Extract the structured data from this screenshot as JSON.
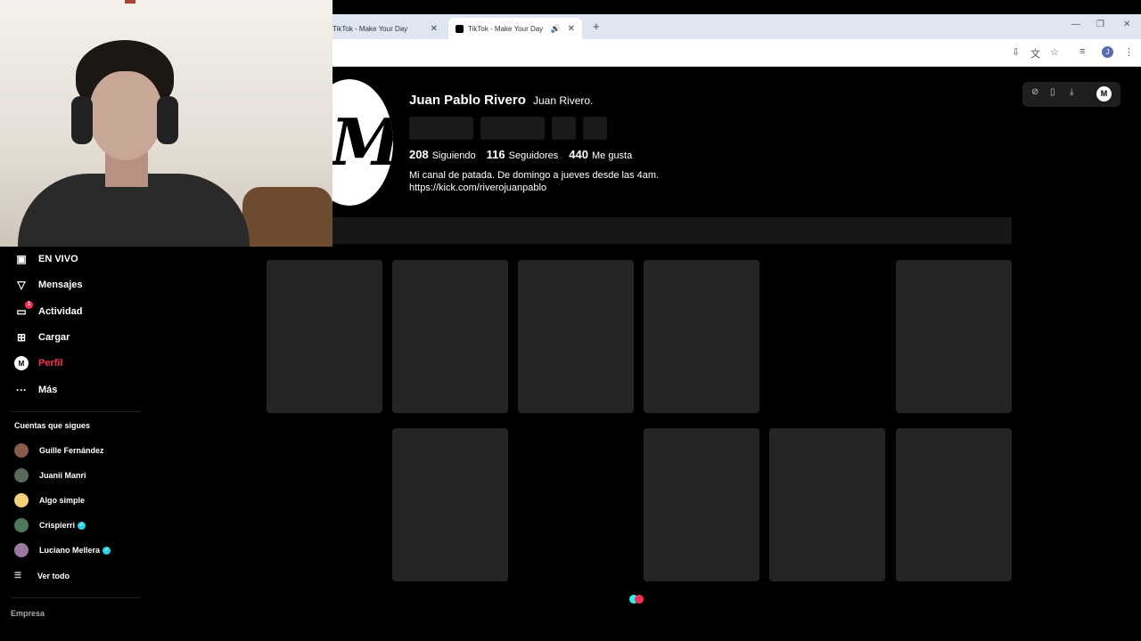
{
  "browser": {
    "tabs": [
      {
        "title": "TikTok - Make Your Day",
        "active": false
      },
      {
        "title": "TikTok - Make Your Day",
        "active": true
      }
    ],
    "new_tab": "+",
    "close_glyph": "✕",
    "speaker_glyph": "🔊",
    "profile_initial": "J",
    "window_controls": [
      "—",
      "❐",
      "✕"
    ]
  },
  "profile": {
    "name": "Juan Pablo Rivero",
    "handle": "Juan Rivero.",
    "stats": [
      {
        "value": "208",
        "label": "Siguiendo"
      },
      {
        "value": "116",
        "label": "Seguidores"
      },
      {
        "value": "440",
        "label": "Me gusta"
      }
    ],
    "bio_line1": "Mi canal de patada. De domingo a jueves desde las 4am.",
    "bio_line2": "https://kick.com/riverojuanpablo",
    "avatar_monogram": "M"
  },
  "sidebar": {
    "items": [
      {
        "label": "EN VIVO",
        "icon": "live-icon"
      },
      {
        "label": "Mensajes",
        "icon": "messages-icon"
      },
      {
        "label": "Actividad",
        "icon": "activity-icon",
        "badge": "1"
      },
      {
        "label": "Cargar",
        "icon": "upload-icon"
      },
      {
        "label": "Perfil",
        "icon": "profile-icon",
        "active": true
      },
      {
        "label": "Más",
        "icon": "more-icon"
      }
    ],
    "following_title": "Cuentas que sigues",
    "following": [
      {
        "name": "Guille Fernández",
        "verified": false,
        "color": "#8a5a4a"
      },
      {
        "name": "Juanii Manri",
        "verified": false,
        "color": "#5a6a5a"
      },
      {
        "name": "Algo simple",
        "verified": false,
        "color": "#f5d27a"
      },
      {
        "name": "Crispierri",
        "verified": true,
        "color": "#4a7a5a"
      },
      {
        "name": "Luciano Mellera",
        "verified": true,
        "color": "#9a7aa0"
      }
    ],
    "see_all": "Ver todo",
    "footer": "Empresa"
  },
  "colors": {
    "accent": "#fe2c55",
    "verified": "#20d5ec",
    "loader_a": "#25f4ee",
    "loader_b": "#fe2c55"
  }
}
